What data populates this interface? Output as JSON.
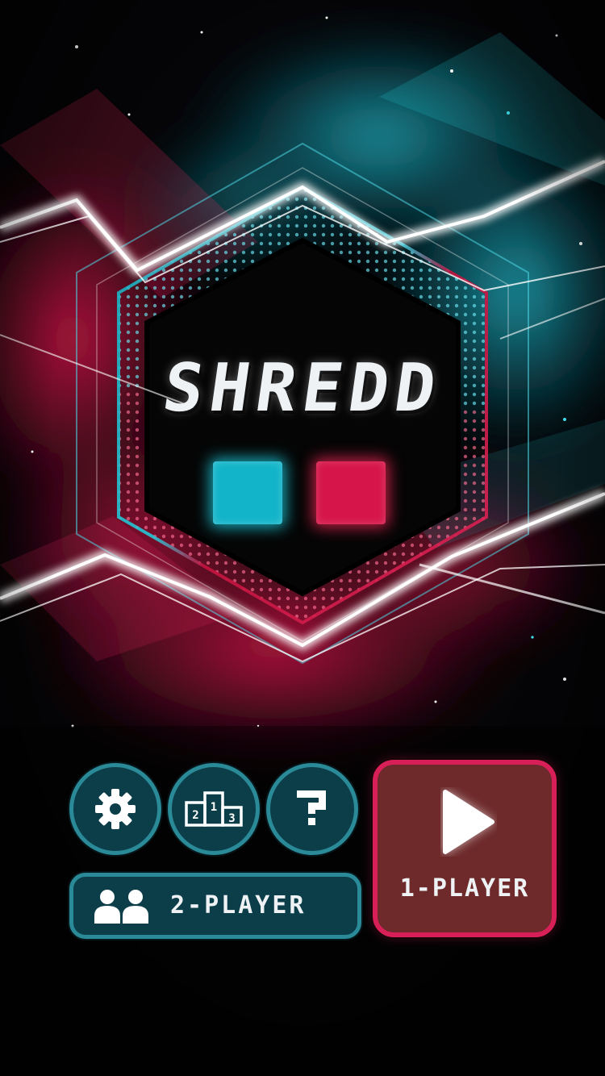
{
  "title": "SHREDD",
  "colors": {
    "accent_cyan": "#12b4c9",
    "accent_red": "#d6164a",
    "button_teal_fill": "#0c3e49",
    "button_teal_border": "#2a8a97",
    "button_red_fill": "#6e2a2b",
    "button_red_border": "#d81f57"
  },
  "buttons": {
    "settings_icon": "gear-icon",
    "leaderboard_icon": "podium-icon",
    "help_icon": "question-icon",
    "two_player_label": "2-PLAYER",
    "two_player_icon": "two-people-icon",
    "one_player_label": "1-PLAYER",
    "one_player_icon": "play-icon"
  },
  "podium": {
    "first": "1",
    "second": "2",
    "third": "3"
  }
}
